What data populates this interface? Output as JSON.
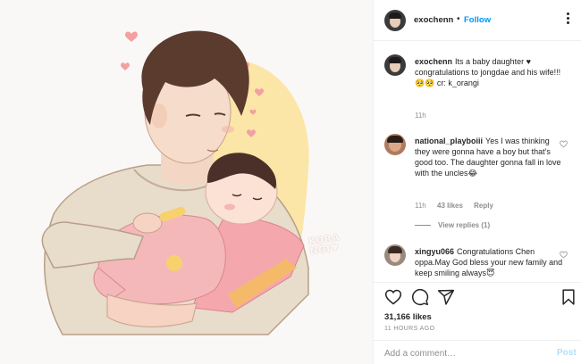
{
  "header": {
    "username": "exochenn",
    "separator": "•",
    "follow_label": "Follow",
    "more_icon": "more-options-icon"
  },
  "artwork": {
    "watermark": "KORA\nNGI♥",
    "colors": {
      "background": "#faf8f6",
      "glow": "#fbe6a8",
      "hearts": "#f2a0a3",
      "sweater": "#e8dccb",
      "onesie": "#f4b8bb",
      "blanket": "#f4a8ad",
      "hair": "#5a3b2e"
    }
  },
  "comments": [
    {
      "username": "exochenn",
      "text": "Its a baby daughter ♥ congratulations to jongdae and his wife!!! 🥺🥺 cr: k_orangi",
      "time": "11h"
    },
    {
      "username": "national_playboiii",
      "text": "Yes I was thinking they were gonna have a boy but that's good too. The daughter gonna fall in love with the uncles😂",
      "time": "11h",
      "likes": "43 likes",
      "reply_label": "Reply",
      "view_replies": "View replies (1)"
    },
    {
      "username": "xingyu066",
      "text": "Congratulations Chen oppa.May God bless your new family and keep smiling always😇"
    }
  ],
  "actions": {
    "icons": [
      "heart-icon",
      "comment-icon",
      "share-icon",
      "bookmark-icon"
    ],
    "likes": "31,166 likes",
    "time_ago": "11 HOURS AGO"
  },
  "add_comment": {
    "placeholder": "Add a comment…",
    "post_label": "Post"
  },
  "colors": {
    "accent": "#0095f6",
    "post_disabled": "#b2dffc",
    "muted": "#8e8e8e",
    "text": "#262626",
    "divider": "#efefef"
  }
}
